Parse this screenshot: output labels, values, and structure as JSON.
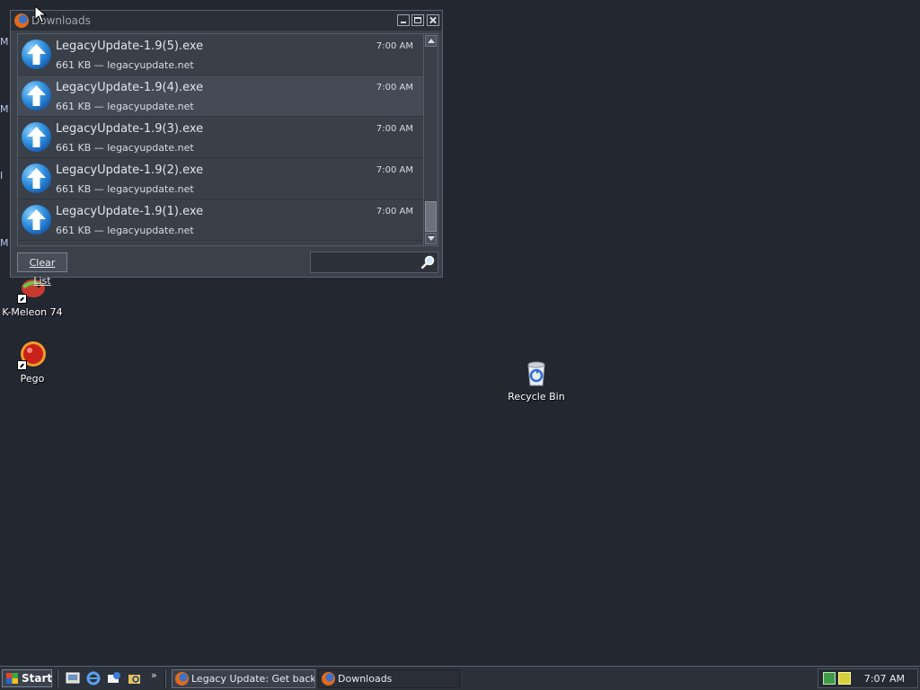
{
  "desktop": {
    "edge_glyphs": [
      "M",
      "M",
      "I",
      "M"
    ],
    "icons": [
      {
        "label": "K-Meleon 74"
      },
      {
        "label": "Pego"
      },
      {
        "label": "Recycle Bin"
      }
    ]
  },
  "downloads_window": {
    "title": "Downloads",
    "items": [
      {
        "name": "LegacyUpdate-1.9(5).exe",
        "meta": "661 KB — legacyupdate.net",
        "time": "7:00 AM"
      },
      {
        "name": "LegacyUpdate-1.9(4).exe",
        "meta": "661 KB — legacyupdate.net",
        "time": "7:00 AM"
      },
      {
        "name": "LegacyUpdate-1.9(3).exe",
        "meta": "661 KB — legacyupdate.net",
        "time": "7:00 AM"
      },
      {
        "name": "LegacyUpdate-1.9(2).exe",
        "meta": "661 KB — legacyupdate.net",
        "time": "7:00 AM"
      },
      {
        "name": "LegacyUpdate-1.9(1).exe",
        "meta": "661 KB — legacyupdate.net",
        "time": "7:00 AM"
      }
    ],
    "clear_label": "Clear List",
    "search": {
      "value": "",
      "placeholder": ""
    }
  },
  "taskbar": {
    "start_label": "Start",
    "quick_launch_more": "»",
    "tasks": [
      {
        "label": "Legacy Update: Get back ..."
      },
      {
        "label": "Downloads"
      }
    ],
    "clock": "7:07 AM"
  },
  "colors": {
    "desktop_bg": "#222730",
    "window_bg": "#3b414b",
    "selected_row": "#444b56",
    "taskbar_bg": "#2c323c"
  }
}
